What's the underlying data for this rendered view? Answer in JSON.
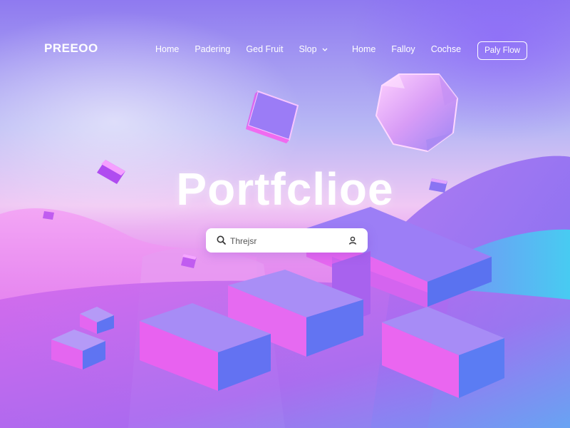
{
  "brand": {
    "logo": "PREEOO"
  },
  "nav": {
    "left_links": [
      "Home",
      "Padering",
      "Ged Fruit"
    ],
    "dropdown_label": "Slop",
    "right_links": [
      "Home",
      "Falloy",
      "Cochse"
    ],
    "cta_label": "Paly Flow"
  },
  "hero": {
    "title": "Portfclioe"
  },
  "search": {
    "placeholder": "Threjsr"
  },
  "icons": {
    "search": "search-icon",
    "user": "user-icon",
    "dropdown": "chevron-down-icon"
  },
  "colors": {
    "accent_purple": "#8f7af0",
    "accent_pink": "#e58ef0",
    "accent_cyan": "#3fc6f0",
    "cube_top": "#b79cff",
    "cube_front": "#e05af0",
    "cube_side": "#5a6af0"
  }
}
